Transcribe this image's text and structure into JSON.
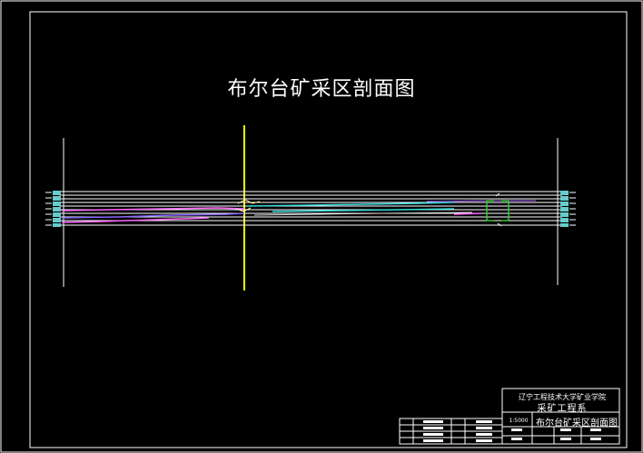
{
  "drawing": {
    "title": "布尔台矿采区剖面图",
    "background": "#000000",
    "colors": {
      "frame": "#ffffff",
      "axis": "#ffff00",
      "seam_magenta": "#ff66ff",
      "seam_blue": "#8866ff",
      "seam_cyan": "#33dddd",
      "marker_green": "#33cc33",
      "well_cyan": "#66cccc"
    }
  },
  "title_block": {
    "school": "辽宁工程技术大学矿业学院",
    "department": "采矿工程系",
    "drawing_name": "布尔台矿采区剖面图",
    "scale": "1:5000"
  }
}
